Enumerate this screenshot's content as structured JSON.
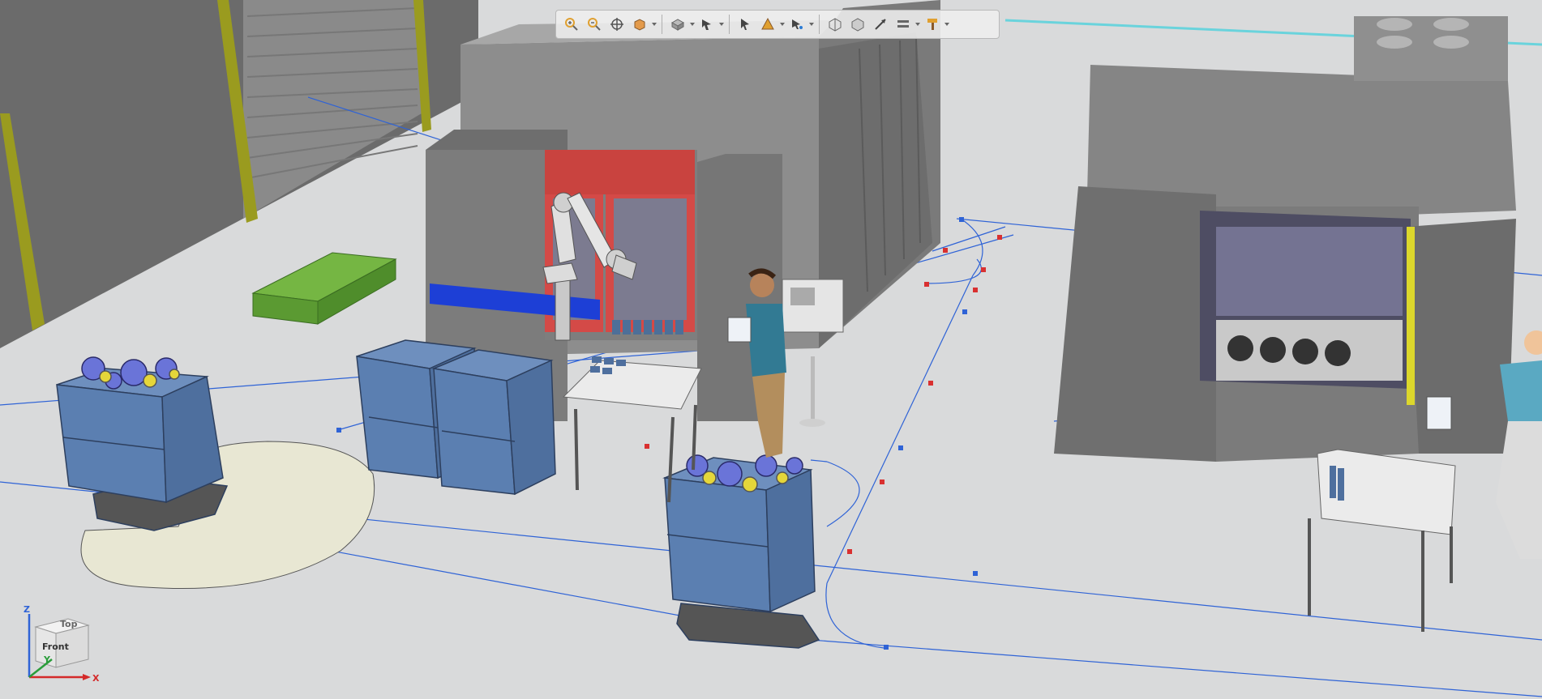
{
  "scene": {
    "description_icons": [
      "robot-arm",
      "operator-figure",
      "mobile-robot",
      "pallet",
      "cnc-machine",
      "storage-box",
      "welding-table",
      "control-panel"
    ]
  },
  "toolbar": {
    "buttons": [
      {
        "name": "zoom-in-icon"
      },
      {
        "name": "zoom-out-icon"
      },
      {
        "name": "pan-icon"
      },
      {
        "name": "orbit-icon",
        "dropdown": true
      },
      {
        "name": "view-style-icon",
        "dropdown": true
      },
      {
        "name": "render-mode-icon",
        "dropdown": true
      },
      {
        "name": "select-icon"
      },
      {
        "name": "measure-icon",
        "dropdown": true
      },
      {
        "name": "snap-icon",
        "dropdown": true
      },
      {
        "name": "box-icon"
      },
      {
        "name": "box-wire-icon"
      },
      {
        "name": "move-axis-icon"
      },
      {
        "name": "grid-icon",
        "dropdown": true
      },
      {
        "name": "paint-icon",
        "dropdown": true
      }
    ]
  },
  "navcube": {
    "face_top": "Top",
    "face_front": "Front",
    "axis_x": "X",
    "axis_y": "Y",
    "axis_z": "Z"
  },
  "colors": {
    "floor": "#d9dadb",
    "machine": "#6e6e6e",
    "machine_light": "#9a9a9a",
    "accent_red": "#d44a47",
    "box_blue": "#5b7fb1",
    "pallet_green": "#6fae3f",
    "guide_line": "#2f63d6",
    "path_dot": "#d93030",
    "safety_zone": "#e8e7d3",
    "wall_stripe": "#9a9b1f"
  }
}
